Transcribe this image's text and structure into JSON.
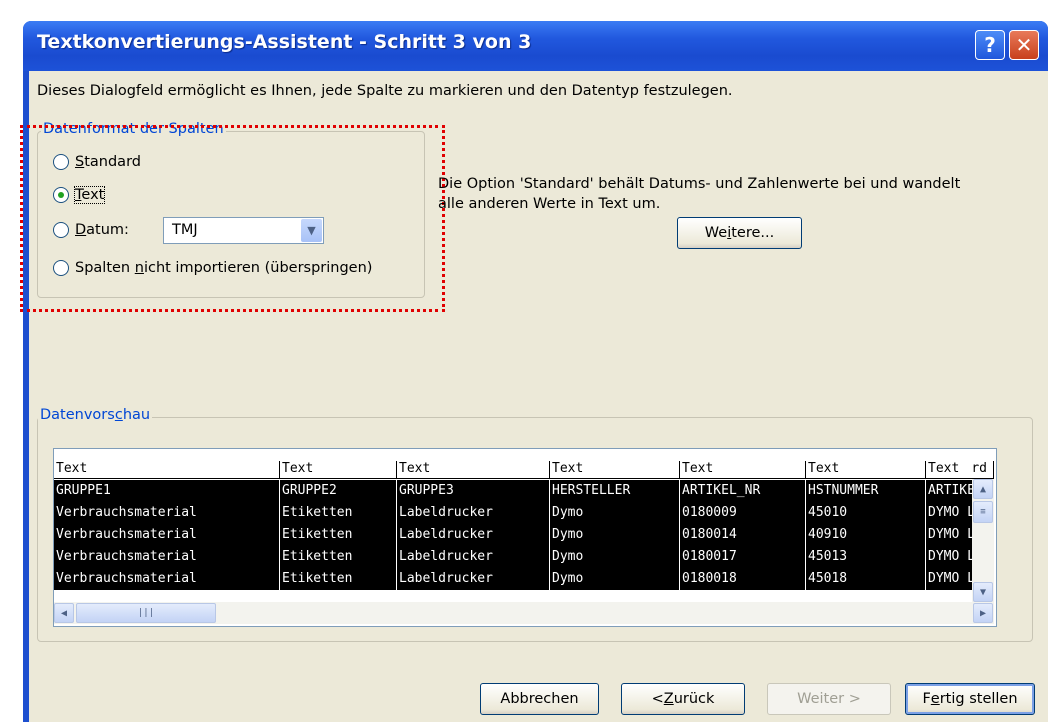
{
  "window": {
    "title": "Textkonvertierungs-Assistent - Schritt 3 von 3",
    "help_label": "?",
    "close_label": "✕"
  },
  "intro": "Dieses Dialogfeld ermöglicht es Ihnen, jede Spalte zu markieren und den Datentyp festzulegen.",
  "column_format": {
    "legend": "Datenformat der Spalten",
    "options": [
      {
        "prefix": "",
        "key": "S",
        "rest": "tandard",
        "checked": false
      },
      {
        "prefix": "",
        "key": "T",
        "rest": "ext",
        "checked": true
      },
      {
        "prefix": "",
        "key": "D",
        "rest": "atum:",
        "checked": false
      },
      {
        "prefix": "Spalten ",
        "key": "n",
        "rest": "icht importieren (überspringen)",
        "checked": false
      }
    ],
    "date_format": "TMJ"
  },
  "info": {
    "line1": "Die Option 'Standard' behält Datums- und Zahlenwerte bei und wandelt",
    "line2": "alle anderen Werte in Text um.",
    "more_button": {
      "prefix": "We",
      "key": "i",
      "rest": "tere..."
    }
  },
  "preview": {
    "legend_prefix": "Datenvors",
    "legend_key": "c",
    "legend_rest": "hau",
    "column_types": [
      "Text",
      "Text",
      "Text",
      "Text",
      "Text",
      "Text",
      "Text"
    ],
    "overflow_header": "rd",
    "rows": [
      [
        "GRUPPE1",
        "GRUPPE2",
        "GRUPPE3",
        "HERSTELLER",
        "ARTIKEL_NR",
        "HSTNUMMER",
        "ARTIKE"
      ],
      [
        "Verbrauchsmaterial",
        "Etiketten",
        "Labeldrucker",
        "Dymo",
        "0180009",
        "45010",
        "DYMO L"
      ],
      [
        "Verbrauchsmaterial",
        "Etiketten",
        "Labeldrucker",
        "Dymo",
        "0180014",
        "40910",
        "DYMO L"
      ],
      [
        "Verbrauchsmaterial",
        "Etiketten",
        "Labeldrucker",
        "Dymo",
        "0180017",
        "45013",
        "DYMO L"
      ],
      [
        "Verbrauchsmaterial",
        "Etiketten",
        "Labeldrucker",
        "Dymo",
        "0180018",
        "45018",
        "DYMO L"
      ]
    ]
  },
  "buttons": {
    "cancel": "Abbrechen",
    "back_prefix": "< ",
    "back_key": "Z",
    "back_rest": "urück",
    "next": "Weiter >",
    "finish_prefix": "F",
    "finish_key": "e",
    "finish_rest": "rtig stellen"
  }
}
